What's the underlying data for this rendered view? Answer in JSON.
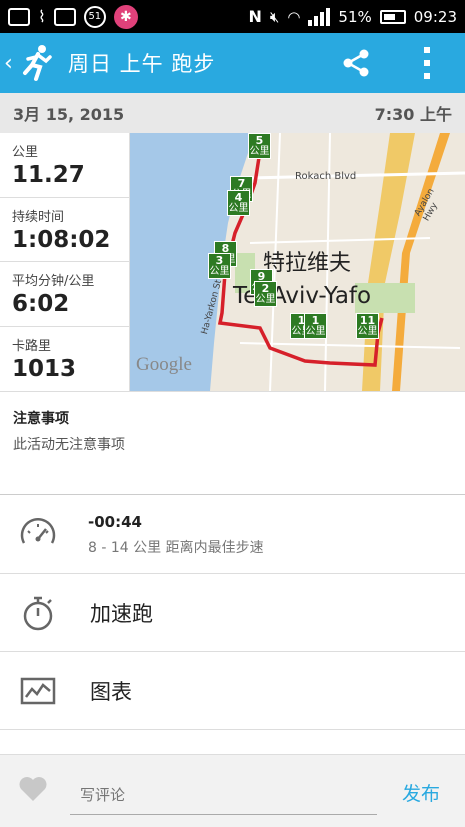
{
  "status_bar": {
    "sim_badge": "51",
    "battery_percent": "51%",
    "time": "09:23",
    "icons": [
      "screen-icon",
      "broom-icon",
      "keyboard-icon",
      "circle-51-icon",
      "pink-app-icon",
      "nfc-icon",
      "mute-icon",
      "wifi-icon",
      "signal-icon",
      "battery-icon"
    ]
  },
  "app_bar": {
    "back_glyph": "‹",
    "title": "周日 上午 跑步"
  },
  "date_bar": {
    "date": "3月 15, 2015",
    "time": "7:30 上午"
  },
  "stats": [
    {
      "label": "公里",
      "value": "11.27"
    },
    {
      "label": "持续时间",
      "value": "1:08:02"
    },
    {
      "label": "平均分钟/公里",
      "value": "6:02"
    },
    {
      "label": "卡路里",
      "value": "1013"
    }
  ],
  "map": {
    "city_name_zh": "特拉维夫",
    "city_name_en": "Tel Aviv-Yafo",
    "street_rokach": "Rokach Blvd",
    "street_hayarkon": "Ha-Yarkon St",
    "street_ayalon": "Ayalon Hwy",
    "attribution": "Google",
    "marker_unit": "公里",
    "markers": [
      "5",
      "7",
      "4",
      "8",
      "3",
      "9",
      "2",
      "1",
      "1",
      "11"
    ]
  },
  "notes": {
    "heading": "注意事项",
    "text": "此活动无注意事项"
  },
  "best_pace": {
    "value": "-00:44",
    "description": "8 - 14 公里 距离内最佳步速"
  },
  "intervals": {
    "label": "加速跑"
  },
  "charts": {
    "label": "图表"
  },
  "comment": {
    "placeholder": "写评论",
    "publish": "发布"
  },
  "colors": {
    "accent": "#29a9e0",
    "marker": "#2d7a23",
    "route": "#d6202a"
  }
}
